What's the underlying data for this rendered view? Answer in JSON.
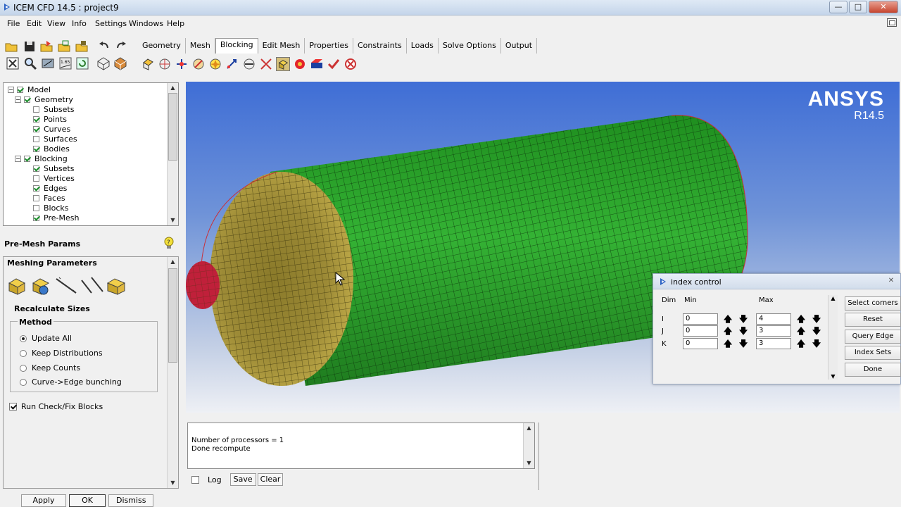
{
  "window": {
    "title": "ICEM CFD 14.5 : project9",
    "minimize": "—",
    "maximize": "□",
    "close": "✕"
  },
  "menu": [
    "File",
    "Edit",
    "View",
    "Info",
    "Settings",
    "Windows",
    "Help"
  ],
  "tabs": [
    "Geometry",
    "Mesh",
    "Blocking",
    "Edit Mesh",
    "Properties",
    "Constraints",
    "Loads",
    "Solve Options",
    "Output"
  ],
  "active_tab": "Blocking",
  "tree": {
    "items": [
      {
        "label": "Model",
        "checked": true
      },
      {
        "label": "Geometry",
        "checked": true
      },
      {
        "label": "Subsets",
        "checked": false
      },
      {
        "label": "Points",
        "checked": true
      },
      {
        "label": "Curves",
        "checked": true
      },
      {
        "label": "Surfaces",
        "checked": false
      },
      {
        "label": "Bodies",
        "checked": true
      },
      {
        "label": "Blocking",
        "checked": true
      },
      {
        "label": "Subsets",
        "checked": true
      },
      {
        "label": "Vertices",
        "checked": false
      },
      {
        "label": "Edges",
        "checked": true
      },
      {
        "label": "Faces",
        "checked": false
      },
      {
        "label": "Blocks",
        "checked": false
      },
      {
        "label": "Pre-Mesh",
        "checked": true
      }
    ]
  },
  "params": {
    "title": "Pre-Mesh Params",
    "meshing_parameters": "Meshing Parameters",
    "recalculate_sizes": "Recalculate Sizes",
    "method": "Method",
    "method_options": [
      "Update All",
      "Keep Distributions",
      "Keep Counts",
      "Curve->Edge bunching"
    ],
    "selected_method": "Update All",
    "run_check": "Run Check/Fix Blocks",
    "run_check_checked": true
  },
  "buttons": {
    "apply": "Apply",
    "ok": "OK",
    "dismiss": "Dismiss"
  },
  "viewport": {
    "brand": "ANSYS",
    "version": "R14.5"
  },
  "messages": {
    "lines": [
      "Number of processors = 1",
      "Done recompute"
    ],
    "log": "Log",
    "save": "Save",
    "clear": "Clear"
  },
  "index_control": {
    "title": "index control",
    "col_dim": "Dim",
    "col_min": "Min",
    "col_max": "Max",
    "rows": [
      {
        "dim": "I",
        "min": "0",
        "max": "4"
      },
      {
        "dim": "J",
        "min": "0",
        "max": "3"
      },
      {
        "dim": "K",
        "min": "0",
        "max": "3"
      }
    ],
    "buttons": [
      "Select corners",
      "Reset",
      "Query Edge",
      "Index Sets",
      "Done"
    ]
  }
}
